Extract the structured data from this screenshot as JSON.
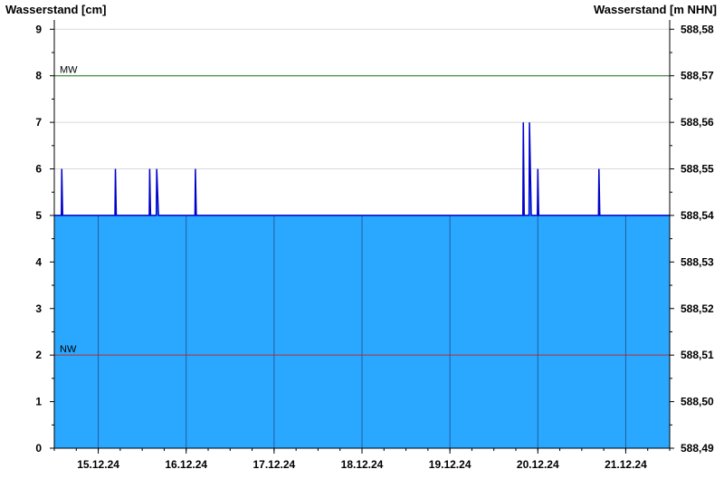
{
  "chart_data": {
    "type": "area",
    "title": "",
    "ylabel_left": "Wasserstand [cm]",
    "ylabel_right": "Wasserstand [m NHN]",
    "ylim_left": [
      0,
      9.2
    ],
    "ylim_right": [
      588.49,
      588.582
    ],
    "yticks_left": [
      "0",
      "1",
      "2",
      "3",
      "4",
      "5",
      "6",
      "7",
      "8",
      "9"
    ],
    "yticks_right": [
      "588,49",
      "588,50",
      "588,51",
      "588,52",
      "588,53",
      "588,54",
      "588,55",
      "588,56",
      "588,57",
      "588,58"
    ],
    "x_dates": [
      "15.12.24",
      "16.12.24",
      "17.12.24",
      "18.12.24",
      "19.12.24",
      "20.12.24",
      "21.12.24"
    ],
    "x_range_days": [
      14.5,
      21.5
    ],
    "day_boundaries": [
      15.0,
      16.0,
      17.0,
      18.0,
      19.0,
      20.0,
      21.0
    ],
    "baseline_cm": 5,
    "series": [
      {
        "values_day_cm": [
          [
            14.5,
            5
          ],
          [
            14.58,
            5
          ],
          [
            14.585,
            6
          ],
          [
            14.595,
            5
          ],
          [
            15.19,
            5
          ],
          [
            15.195,
            6
          ],
          [
            15.205,
            5
          ],
          [
            15.58,
            5
          ],
          [
            15.585,
            6
          ],
          [
            15.595,
            5
          ],
          [
            15.66,
            5
          ],
          [
            15.665,
            6
          ],
          [
            15.685,
            5
          ],
          [
            16.1,
            5
          ],
          [
            16.105,
            6
          ],
          [
            16.115,
            5
          ],
          [
            19.83,
            5
          ],
          [
            19.835,
            7
          ],
          [
            19.845,
            5
          ],
          [
            19.9,
            5
          ],
          [
            19.905,
            7
          ],
          [
            19.915,
            6
          ],
          [
            19.925,
            5
          ],
          [
            19.995,
            5
          ],
          [
            20.0,
            6
          ],
          [
            20.01,
            5
          ],
          [
            20.69,
            5
          ],
          [
            20.695,
            6
          ],
          [
            20.705,
            5
          ],
          [
            21.5,
            5
          ]
        ]
      }
    ],
    "reference_lines": [
      {
        "label": "MW",
        "value_cm": 8,
        "color": "#1a7a1a"
      },
      {
        "label": "NW",
        "value_cm": 2,
        "color": "#b03030"
      }
    ],
    "colors": {
      "fill": "#2aa8ff",
      "line": "#0000cc",
      "grid": "#d9d9d9",
      "day_line": "#1e5fa0"
    },
    "grid": true
  }
}
